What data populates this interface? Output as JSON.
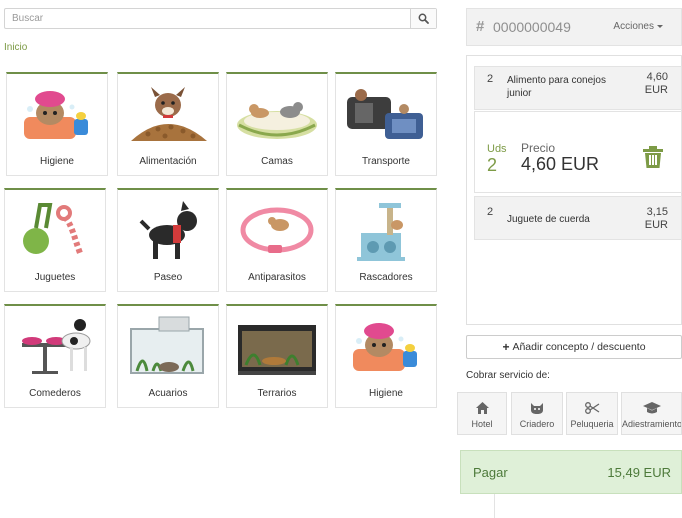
{
  "search": {
    "placeholder": "Buscar",
    "icon": "search-icon"
  },
  "breadcrumb": "Inicio",
  "categories": [
    {
      "label": "Higiene",
      "icon": "dog-bath-image"
    },
    {
      "label": "Alimentación",
      "icon": "dog-food-image"
    },
    {
      "label": "Camas",
      "icon": "pet-bed-image"
    },
    {
      "label": "Transporte",
      "icon": "pet-carrier-image"
    },
    {
      "label": "Juguetes",
      "icon": "rope-toy-image"
    },
    {
      "label": "Paseo",
      "icon": "dog-harness-image"
    },
    {
      "label": "Antiparasitos",
      "icon": "flea-collar-image"
    },
    {
      "label": "Rascadores",
      "icon": "cat-scratcher-image"
    },
    {
      "label": "Comederos",
      "icon": "dog-bowls-image"
    },
    {
      "label": "Acuarios",
      "icon": "aquarium-image"
    },
    {
      "label": "Terrarios",
      "icon": "terrarium-image"
    },
    {
      "label": "Higiene",
      "icon": "dog-bath-image"
    }
  ],
  "order": {
    "number": "0000000049",
    "actions_label": "Acciones",
    "lines": [
      {
        "qty": "2",
        "name": "Alimento para conejos junior",
        "price_value": "4,60",
        "currency": "EUR"
      },
      {
        "qty": "2",
        "name": "Juguete de cuerda",
        "price_value": "3,15",
        "currency": "EUR"
      }
    ],
    "detail": {
      "units_label": "Uds",
      "units_value": "2",
      "price_label": "Precio",
      "price_value": "4,60 EUR"
    }
  },
  "add_concept_label": "Añadir concepto / descuento",
  "services_label": "Cobrar servicio de:",
  "services": [
    {
      "label": "Hotel",
      "icon": "house-icon"
    },
    {
      "label": "Criadero",
      "icon": "cat-face-icon"
    },
    {
      "label": "Peluqueria",
      "icon": "scissors-icon"
    },
    {
      "label": "Adiestramiento",
      "icon": "graduation-cap-icon"
    }
  ],
  "pay": {
    "label": "Pagar",
    "total": "15,49 EUR"
  },
  "colors": {
    "accent": "#7d9b46",
    "tile_border": "#6f8f48",
    "pay_bg": "#dff0d8",
    "pay_text": "#4d7a3a"
  }
}
